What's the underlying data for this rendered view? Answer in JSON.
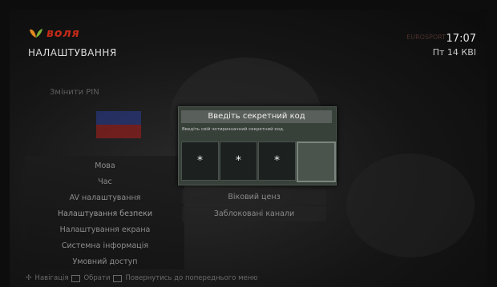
{
  "header": {
    "brand": "воля",
    "section_title": "НАЛАШТУВАННЯ",
    "time": "17:07",
    "date": "Пт 14 КВІ",
    "channel_ghost": "EUROSPORT"
  },
  "background": {
    "change_pin": "Змінити PIN"
  },
  "menu": {
    "items": [
      "Мова",
      "Час",
      "AV налаштування",
      "Налаштування безпеки",
      "Налаштування екрана",
      "Системна інформація",
      "Умовний доступ"
    ]
  },
  "right_panel": {
    "items": [
      "Віковий ценз",
      "Заблоковані канали"
    ]
  },
  "dialog": {
    "title": "Введіть секретний код",
    "subtitle": "Введіть свій чотиризначний секретний код.",
    "pin": [
      "*",
      "*",
      "*",
      ""
    ]
  },
  "footer": {
    "navigation": "Навігація",
    "select": "Обрати",
    "back": "Повернутись до попереднього меню"
  },
  "colors": {
    "brand_red": "#c62a18",
    "dialog_bg": "#38403a"
  }
}
